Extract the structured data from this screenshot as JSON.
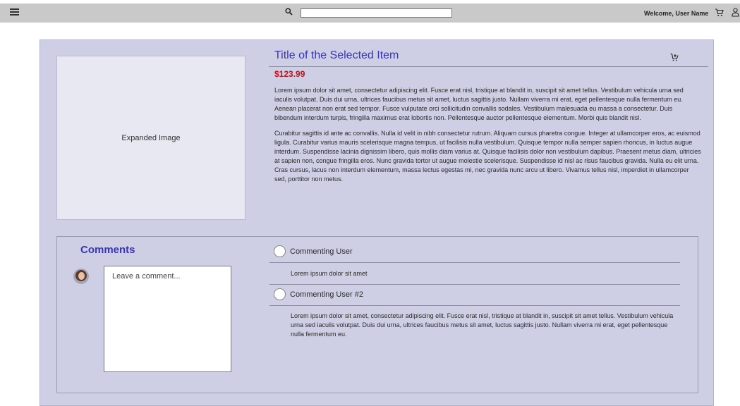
{
  "topbar": {
    "search": {
      "value": "",
      "placeholder": ""
    },
    "welcome": "Welcome, User Name"
  },
  "item": {
    "image_label": "Expanded Image",
    "title": "Title of the Selected Item",
    "price": "$123.99",
    "description": [
      "Lorem ipsum dolor sit amet, consectetur adipiscing elit. Fusce erat nisl, tristique at blandit in, suscipit sit amet tellus. Vestibulum vehicula urna sed iaculis volutpat. Duis dui urna, ultrices faucibus metus sit amet, luctus sagittis justo. Nullam viverra mi erat, eget pellentesque nulla fermentum eu. Aenean placerat non erat sed tempor. Fusce vulputate orci sollicitudin convallis sodales. Vestibulum malesuada eu massa a consectetur. Duis bibendum interdum turpis, fringilla maximus erat lobortis non. Pellentesque auctor pellentesque elementum. Morbi quis blandit nisl.",
      "Curabitur sagittis id ante ac convallis. Nulla id velit in nibh consectetur rutrum. Aliquam cursus pharetra congue. Integer at ullamcorper eros, ac euismod ligula. Curabitur varius mauris scelerisque magna tempus, ut facilisis nulla vestibulum. Quisque tempor nulla semper sapien rhoncus, in luctus augue interdum. Suspendisse lacinia dignissim libero, quis mollis diam varius at. Quisque facilisis dolor non vestibulum dapibus. Praesent metus diam, ultricies at sapien non, congue fringilla eros. Nunc gravida tortor ut augue molestie scelerisque. Suspendisse id nisl ac risus faucibus gravida. Nulla eu elit urna. Cras cursus, lacus non interdum elementum, massa lectus egestas mi, nec gravida nunc arcu ut libero. Vivamus tellus nisl, imperdiet in ullamcorper sed, porttitor non metus."
    ]
  },
  "comments": {
    "heading": "Comments",
    "input_placeholder": "Leave a comment...",
    "items": [
      {
        "user": "Commenting User",
        "text": "Lorem ipsum dolor sit amet"
      },
      {
        "user": "Commenting User #2",
        "text": "Lorem ipsum dolor sit amet, consectetur adipiscing elit. Fusce erat nisl, tristique at blandit in, suscipit sit amet tellus. Vestibulum vehicula urna sed iaculis volutpat. Duis dui urna, ultrices faucibus metus sit amet, luctus sagittis justo. Nullam viverra mi erat, eget pellentesque nulla fermentum eu."
      }
    ]
  },
  "icons": {
    "menu": "hamburger-menu-icon",
    "search": "search-icon",
    "cart": "cart-icon",
    "user": "user-icon",
    "add_to_cart": "add-to-cart-icon"
  },
  "colors": {
    "accent": "#3a35b5",
    "price": "#c4111c",
    "panel": "#cecfe4",
    "topbar": "#c9c9c9"
  }
}
